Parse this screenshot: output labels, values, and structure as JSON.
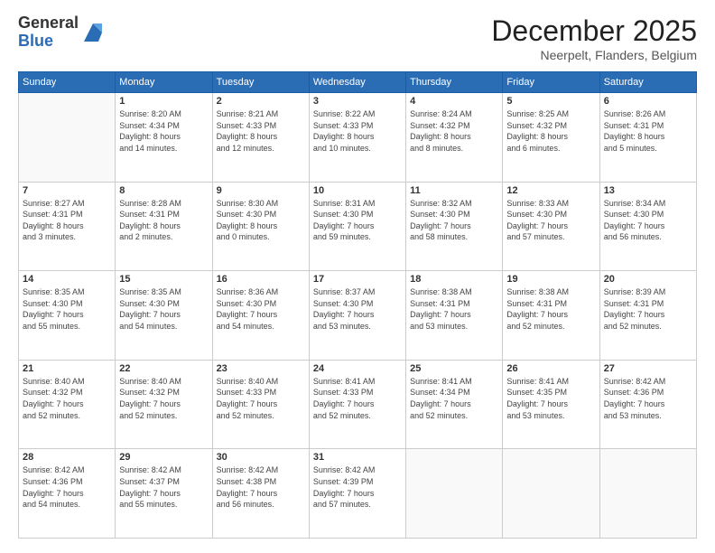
{
  "logo": {
    "general": "General",
    "blue": "Blue"
  },
  "title": "December 2025",
  "subtitle": "Neerpelt, Flanders, Belgium",
  "days_header": [
    "Sunday",
    "Monday",
    "Tuesday",
    "Wednesday",
    "Thursday",
    "Friday",
    "Saturday"
  ],
  "weeks": [
    [
      {
        "day": "",
        "info": ""
      },
      {
        "day": "1",
        "info": "Sunrise: 8:20 AM\nSunset: 4:34 PM\nDaylight: 8 hours\nand 14 minutes."
      },
      {
        "day": "2",
        "info": "Sunrise: 8:21 AM\nSunset: 4:33 PM\nDaylight: 8 hours\nand 12 minutes."
      },
      {
        "day": "3",
        "info": "Sunrise: 8:22 AM\nSunset: 4:33 PM\nDaylight: 8 hours\nand 10 minutes."
      },
      {
        "day": "4",
        "info": "Sunrise: 8:24 AM\nSunset: 4:32 PM\nDaylight: 8 hours\nand 8 minutes."
      },
      {
        "day": "5",
        "info": "Sunrise: 8:25 AM\nSunset: 4:32 PM\nDaylight: 8 hours\nand 6 minutes."
      },
      {
        "day": "6",
        "info": "Sunrise: 8:26 AM\nSunset: 4:31 PM\nDaylight: 8 hours\nand 5 minutes."
      }
    ],
    [
      {
        "day": "7",
        "info": "Sunrise: 8:27 AM\nSunset: 4:31 PM\nDaylight: 8 hours\nand 3 minutes."
      },
      {
        "day": "8",
        "info": "Sunrise: 8:28 AM\nSunset: 4:31 PM\nDaylight: 8 hours\nand 2 minutes."
      },
      {
        "day": "9",
        "info": "Sunrise: 8:30 AM\nSunset: 4:30 PM\nDaylight: 8 hours\nand 0 minutes."
      },
      {
        "day": "10",
        "info": "Sunrise: 8:31 AM\nSunset: 4:30 PM\nDaylight: 7 hours\nand 59 minutes."
      },
      {
        "day": "11",
        "info": "Sunrise: 8:32 AM\nSunset: 4:30 PM\nDaylight: 7 hours\nand 58 minutes."
      },
      {
        "day": "12",
        "info": "Sunrise: 8:33 AM\nSunset: 4:30 PM\nDaylight: 7 hours\nand 57 minutes."
      },
      {
        "day": "13",
        "info": "Sunrise: 8:34 AM\nSunset: 4:30 PM\nDaylight: 7 hours\nand 56 minutes."
      }
    ],
    [
      {
        "day": "14",
        "info": "Sunrise: 8:35 AM\nSunset: 4:30 PM\nDaylight: 7 hours\nand 55 minutes."
      },
      {
        "day": "15",
        "info": "Sunrise: 8:35 AM\nSunset: 4:30 PM\nDaylight: 7 hours\nand 54 minutes."
      },
      {
        "day": "16",
        "info": "Sunrise: 8:36 AM\nSunset: 4:30 PM\nDaylight: 7 hours\nand 54 minutes."
      },
      {
        "day": "17",
        "info": "Sunrise: 8:37 AM\nSunset: 4:30 PM\nDaylight: 7 hours\nand 53 minutes."
      },
      {
        "day": "18",
        "info": "Sunrise: 8:38 AM\nSunset: 4:31 PM\nDaylight: 7 hours\nand 53 minutes."
      },
      {
        "day": "19",
        "info": "Sunrise: 8:38 AM\nSunset: 4:31 PM\nDaylight: 7 hours\nand 52 minutes."
      },
      {
        "day": "20",
        "info": "Sunrise: 8:39 AM\nSunset: 4:31 PM\nDaylight: 7 hours\nand 52 minutes."
      }
    ],
    [
      {
        "day": "21",
        "info": "Sunrise: 8:40 AM\nSunset: 4:32 PM\nDaylight: 7 hours\nand 52 minutes."
      },
      {
        "day": "22",
        "info": "Sunrise: 8:40 AM\nSunset: 4:32 PM\nDaylight: 7 hours\nand 52 minutes."
      },
      {
        "day": "23",
        "info": "Sunrise: 8:40 AM\nSunset: 4:33 PM\nDaylight: 7 hours\nand 52 minutes."
      },
      {
        "day": "24",
        "info": "Sunrise: 8:41 AM\nSunset: 4:33 PM\nDaylight: 7 hours\nand 52 minutes."
      },
      {
        "day": "25",
        "info": "Sunrise: 8:41 AM\nSunset: 4:34 PM\nDaylight: 7 hours\nand 52 minutes."
      },
      {
        "day": "26",
        "info": "Sunrise: 8:41 AM\nSunset: 4:35 PM\nDaylight: 7 hours\nand 53 minutes."
      },
      {
        "day": "27",
        "info": "Sunrise: 8:42 AM\nSunset: 4:36 PM\nDaylight: 7 hours\nand 53 minutes."
      }
    ],
    [
      {
        "day": "28",
        "info": "Sunrise: 8:42 AM\nSunset: 4:36 PM\nDaylight: 7 hours\nand 54 minutes."
      },
      {
        "day": "29",
        "info": "Sunrise: 8:42 AM\nSunset: 4:37 PM\nDaylight: 7 hours\nand 55 minutes."
      },
      {
        "day": "30",
        "info": "Sunrise: 8:42 AM\nSunset: 4:38 PM\nDaylight: 7 hours\nand 56 minutes."
      },
      {
        "day": "31",
        "info": "Sunrise: 8:42 AM\nSunset: 4:39 PM\nDaylight: 7 hours\nand 57 minutes."
      },
      {
        "day": "",
        "info": ""
      },
      {
        "day": "",
        "info": ""
      },
      {
        "day": "",
        "info": ""
      }
    ]
  ]
}
